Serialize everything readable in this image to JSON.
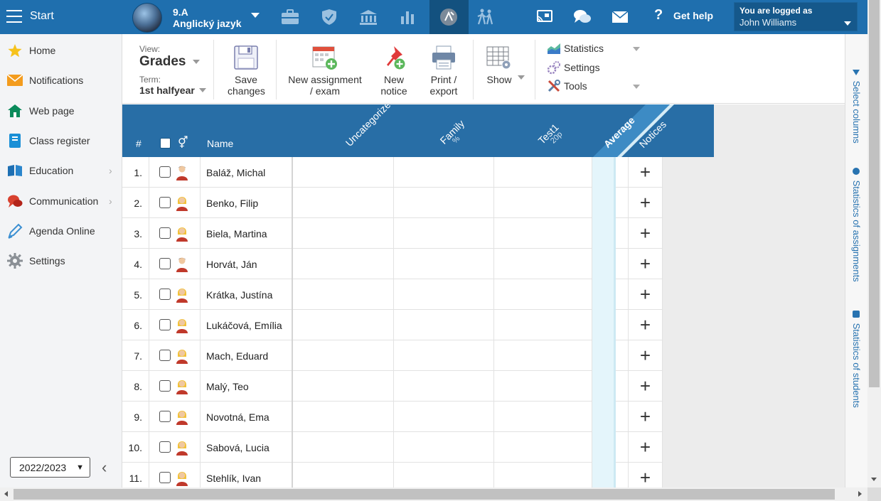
{
  "topbar": {
    "start_label": "Start",
    "class_code": "9.A",
    "subject": "Anglický jazyk",
    "help_label": "Get help",
    "logged_title": "You are logged as",
    "logged_name": "John Williams"
  },
  "sidebar": {
    "items": [
      {
        "label": "Home",
        "icon": "star-icon"
      },
      {
        "label": "Notifications",
        "icon": "envelope-icon"
      },
      {
        "label": "Web page",
        "icon": "house-icon"
      },
      {
        "label": "Class register",
        "icon": "book-icon"
      },
      {
        "label": "Education",
        "icon": "open-book-icon",
        "has_sub": true
      },
      {
        "label": "Communication",
        "icon": "chat-icon",
        "has_sub": true
      },
      {
        "label": "Agenda Online",
        "icon": "pen-icon"
      },
      {
        "label": "Settings",
        "icon": "gear-icon"
      }
    ],
    "year": "2022/2023",
    "chevron": "›",
    "collapse": "‹"
  },
  "toolbar": {
    "view_label": "View:",
    "view_value": "Grades",
    "term_label": "Term:",
    "term_value": "1st halfyear",
    "save_line1": "Save",
    "save_line2": "changes",
    "newassign_line1": "New assignment",
    "newassign_line2": "/ exam",
    "newnotice_line1": "New",
    "newnotice_line2": "notice",
    "print_line1": "Print /",
    "print_line2": "export",
    "show_label": "Show",
    "menu_statistics": "Statistics",
    "menu_settings": "Settings",
    "menu_tools": "Tools"
  },
  "right_panel": {
    "select_columns": "Select columns",
    "stats_assignments": "Statistics of assignments",
    "stats_students": "Statistics of students"
  },
  "grid": {
    "col_num": "#",
    "col_name": "Name",
    "col_uncat": "Uncategorized",
    "col_family": "Family",
    "col_family_sub": "%",
    "col_test": "Test1",
    "col_test_sub": "20p",
    "col_avg": "Average",
    "col_notices": "Notices",
    "add_glyph": "+",
    "rows": [
      {
        "num": "1.",
        "name": "Baláž, Michal",
        "gender": "m"
      },
      {
        "num": "2.",
        "name": "Benko, Filip",
        "gender": "f"
      },
      {
        "num": "3.",
        "name": "Biela, Martina",
        "gender": "f"
      },
      {
        "num": "4.",
        "name": "Horvát, Ján",
        "gender": "m"
      },
      {
        "num": "5.",
        "name": "Krátka, Justína",
        "gender": "f"
      },
      {
        "num": "6.",
        "name": "Lukáčová, Emília",
        "gender": "f"
      },
      {
        "num": "7.",
        "name": "Mach, Eduard",
        "gender": "f"
      },
      {
        "num": "8.",
        "name": "Malý, Teo",
        "gender": "f"
      },
      {
        "num": "9.",
        "name": "Novotná, Ema",
        "gender": "f"
      },
      {
        "num": "10.",
        "name": "Sabová, Lucia",
        "gender": "f"
      },
      {
        "num": "11.",
        "name": "Stehlík, Ivan",
        "gender": "f"
      }
    ]
  },
  "colors": {
    "topbar": "#1f6fae",
    "header": "#286ea6",
    "accent": "#2873b0"
  }
}
